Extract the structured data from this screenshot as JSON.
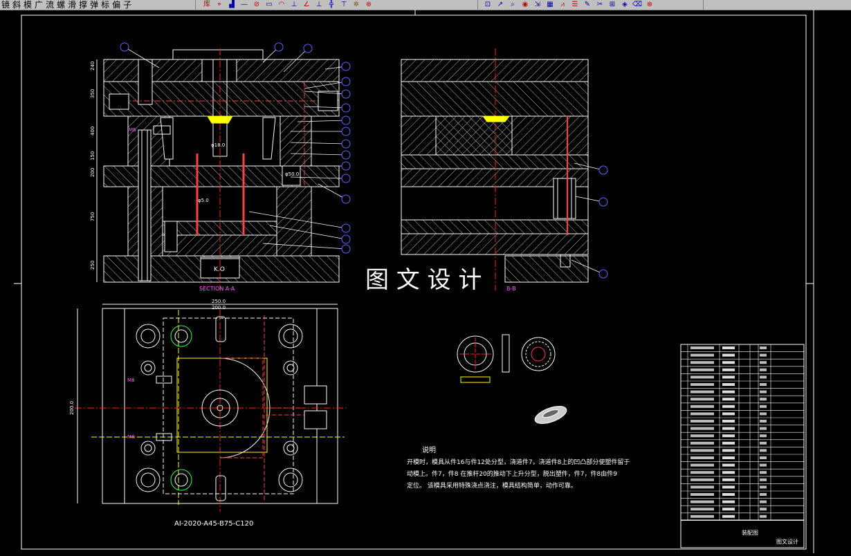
{
  "toolbar": {
    "menu_items": [
      "镜",
      "斜",
      "模",
      "广",
      "流",
      "螺",
      "滑",
      "撑",
      "弹",
      "标",
      "偏",
      "子"
    ],
    "tools_a": [
      {
        "icon": "library-icon",
        "glyph": "库",
        "color": "#c00000"
      },
      {
        "icon": "pointer-icon",
        "glyph": "⌖",
        "color": "#c00000"
      },
      {
        "icon": "plate-icon",
        "glyph": "▟",
        "color": "#0000a0"
      },
      {
        "icon": "line-icon",
        "glyph": "—",
        "color": "#0000a0"
      },
      {
        "icon": "circle-icon",
        "glyph": "⊘",
        "color": "#c00000"
      },
      {
        "icon": "rect-icon",
        "glyph": "▭",
        "color": "#0000a0"
      },
      {
        "icon": "arc-icon",
        "glyph": "◠",
        "color": "#c00000"
      },
      {
        "icon": "pin-icon",
        "glyph": "⊥",
        "color": "#0000a0"
      },
      {
        "icon": "angle-icon",
        "glyph": "∠",
        "color": "#c00000"
      },
      {
        "icon": "pin2-icon",
        "glyph": "⊥",
        "color": "#0000a0"
      },
      {
        "icon": "cross-icon",
        "glyph": "╬",
        "color": "#0000a0"
      },
      {
        "icon": "gate-icon",
        "glyph": "⊤",
        "color": "#0000a0"
      },
      {
        "icon": "gear-icon",
        "glyph": "✲",
        "color": "#805000"
      },
      {
        "icon": "target-icon",
        "glyph": "⊕",
        "color": "#c00000"
      }
    ],
    "tools_b": [
      {
        "icon": "dimension-icon",
        "glyph": "⊡",
        "color": "#0000a0"
      },
      {
        "icon": "leader-icon",
        "glyph": "↗",
        "color": "#0000a0"
      },
      {
        "icon": "zoom-icon",
        "glyph": "⌕",
        "color": "#0000a0"
      },
      {
        "icon": "balloon-icon",
        "glyph": "◉",
        "color": "#c00000"
      },
      {
        "icon": "arrow-icon",
        "glyph": "⇲",
        "color": "#0000a0"
      },
      {
        "icon": "table-icon",
        "glyph": "▦",
        "color": "#0000a0"
      },
      {
        "icon": "hatch-icon",
        "glyph": "⩘",
        "color": "#c00000"
      },
      {
        "icon": "list-icon",
        "glyph": "☰",
        "color": "#c00000"
      },
      {
        "icon": "edit-icon",
        "glyph": "✎",
        "color": "#0000a0"
      },
      {
        "icon": "trim-icon",
        "glyph": "✂",
        "color": "#0000a0"
      },
      {
        "icon": "insert-icon",
        "glyph": "⊞",
        "color": "#0000a0"
      },
      {
        "icon": "bucket-icon",
        "glyph": "◈",
        "color": "#0000a0"
      },
      {
        "icon": "erase-icon",
        "glyph": "⌫",
        "color": "#0000a0"
      },
      {
        "icon": "stop-icon",
        "glyph": "⊗",
        "color": "#c00000"
      }
    ]
  },
  "drawing": {
    "section_a_label": "SECTION A-A",
    "section_b_label": "B-B",
    "watermark": "图 文 设 计",
    "model_number": "AI-2020-A45-B75-C120",
    "note_title": "说明",
    "note_line1": "开模时，模具从件16与件12处分型，浇道件7，浇道件8上的凹凸部分使塑件留于",
    "note_line2": "动模上。件7，件8   在推杆20的推动下上升分型，脱出塑件，件7，件8由件9",
    "note_line3": "定位。   该模具采用特殊浇点浇注，模具结构简单，动作可靠。",
    "bottom_view_dims": {
      "w1": "250.0",
      "w2": "200.0",
      "h1": "200.0"
    },
    "stack_dims": [
      "240",
      "350",
      "400",
      "150",
      "200",
      "750",
      "250"
    ],
    "ko_label": "K.O",
    "m_labels": [
      "M8",
      "M8",
      "M8"
    ],
    "diameter_labels": [
      "φ18.0",
      "φ5.0",
      "φ50.0"
    ],
    "part_label": "件号",
    "title_block": {
      "drawing_name": "装配图",
      "company": "图文设计"
    }
  },
  "bom_rows": 24,
  "colors": {
    "bg": "#000000",
    "line": "#ffffff",
    "hatch": "#c8c8c8",
    "balloon": "#6060ff",
    "center": "#ff2020",
    "dim": "#ff60ff",
    "yellow": "#ffff00",
    "green": "#40ff40"
  }
}
